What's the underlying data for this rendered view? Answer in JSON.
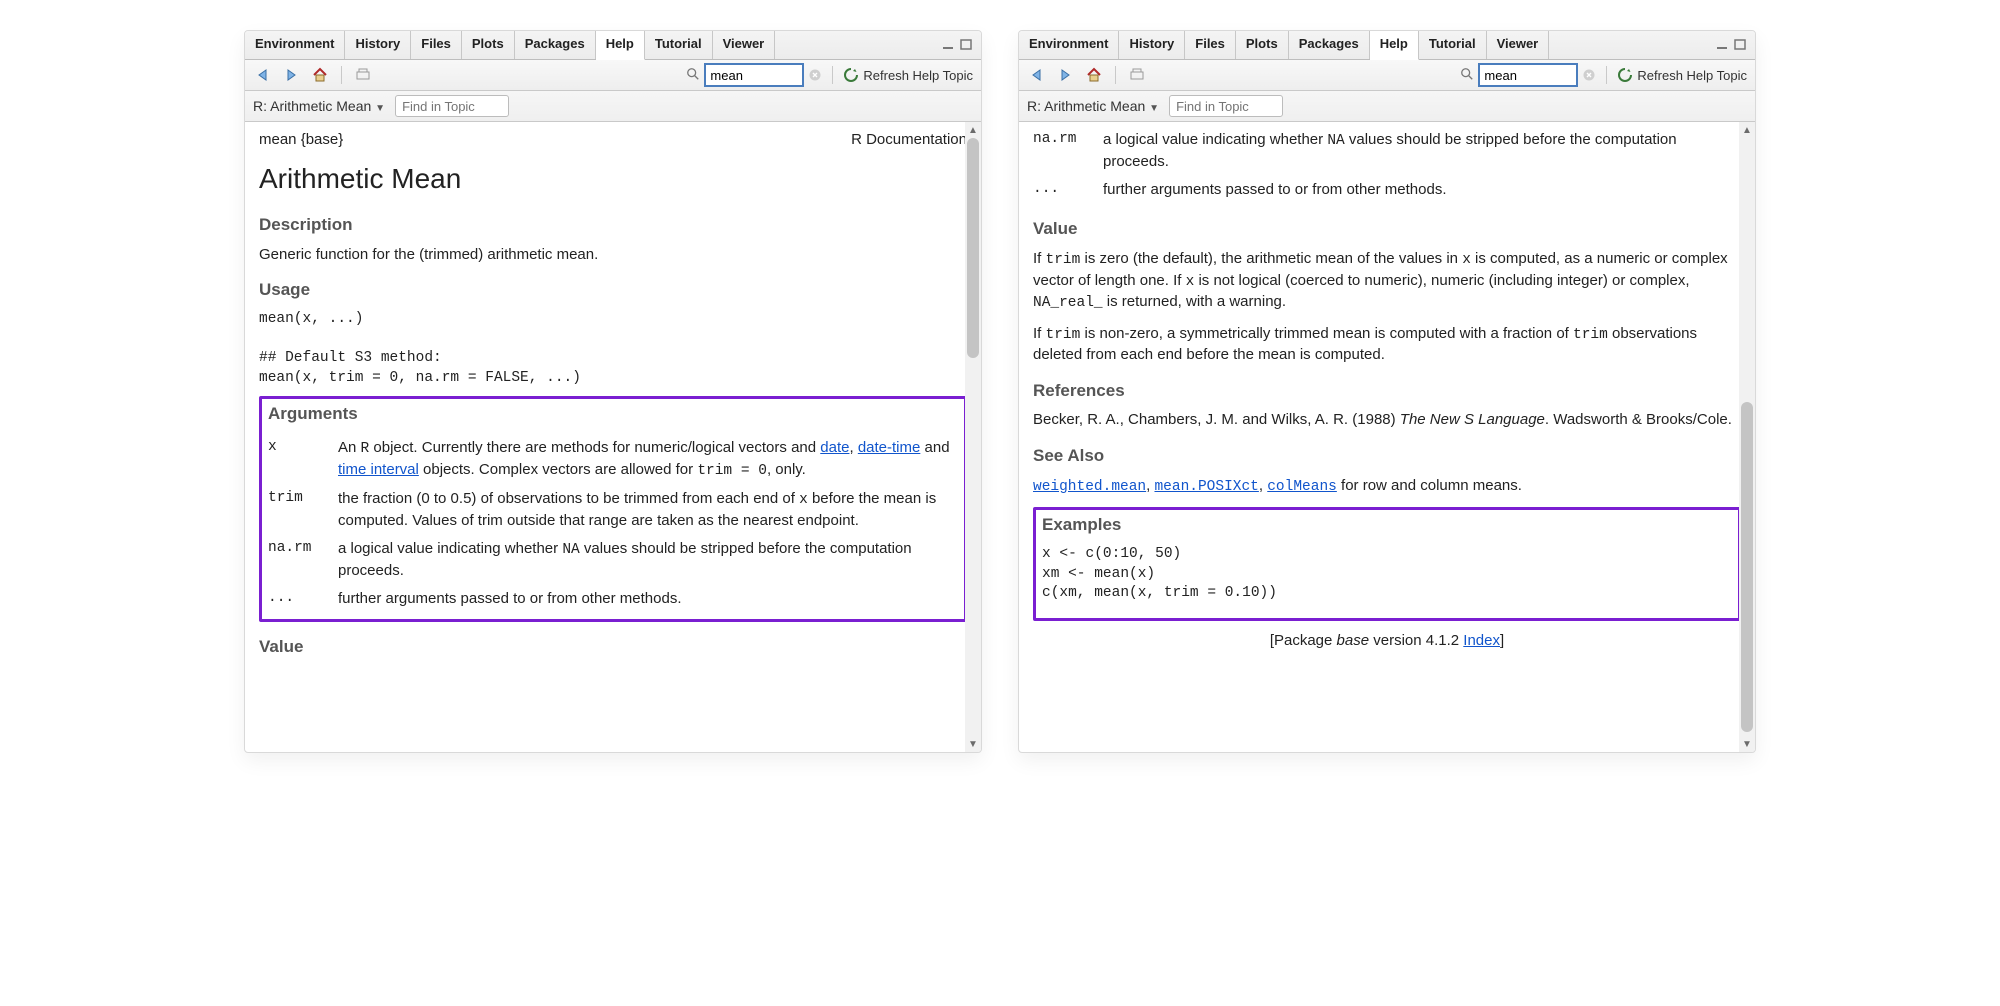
{
  "tabs": {
    "environment": "Environment",
    "history": "History",
    "files": "Files",
    "plots": "Plots",
    "packages": "Packages",
    "help": "Help",
    "tutorial": "Tutorial",
    "viewer": "Viewer"
  },
  "toolbar": {
    "search_value": "mean",
    "refresh": "Refresh Help Topic",
    "find_placeholder": "Find in Topic",
    "topic_label": "R: Arithmetic Mean"
  },
  "doc": {
    "pkg": "mean {base}",
    "rdoc": "R Documentation",
    "title": "Arithmetic Mean",
    "h_desc": "Description",
    "desc": "Generic function for the (trimmed) arithmetic mean.",
    "h_usage": "Usage",
    "usage": "mean(x, ...)\n\n## Default S3 method:\nmean(x, trim = 0, na.rm = FALSE, ...)",
    "h_args": "Arguments",
    "args_x_pre": "An ",
    "args_x_mid": " object. Currently there are methods for numeric/logical vectors and ",
    "link_date": "date",
    "args_x_comma": ", ",
    "link_datetime": "date-time",
    "args_x_and": " and ",
    "link_timeint": "time interval",
    "args_x_post1": " objects. Complex vectors are allowed for ",
    "args_x_code": "trim = 0",
    "args_x_post2": ", only.",
    "args_trim_pre": "the fraction (0 to 0.5) of observations to be trimmed from each end of ",
    "args_trim_post": " before the mean is computed. Values of trim outside that range are taken as the nearest endpoint.",
    "args_narm_pre": "a logical value indicating whether ",
    "args_narm_post": " values should be stripped before the computation proceeds.",
    "args_dots": "further arguments passed to or from other methods.",
    "argname_x": "x",
    "argname_trim": "trim",
    "argname_narm": "na.rm",
    "argname_dots": "...",
    "code_R": "R",
    "code_x": "x",
    "code_NA": "NA",
    "h_value": "Value",
    "value1a": "If ",
    "value1b": " is zero (the default), the arithmetic mean of the values in ",
    "value1c": " is computed, as a numeric or complex vector of length one. If ",
    "value1d": " is not logical (coerced to numeric), numeric (including integer) or complex, ",
    "value1e": " is returned, with a warning.",
    "value2a": "If ",
    "value2b": " is non-zero, a symmetrically trimmed mean is computed with a fraction of ",
    "value2c": " observations deleted from each end before the mean is computed.",
    "code_trim": "trim",
    "code_NAreal": "NA_real_",
    "h_refs": "References",
    "refs_a": "Becker, R. A., Chambers, J. M. and Wilks, A. R. (1988) ",
    "refs_i": "The New S Language",
    "refs_b": ". Wadsworth & Brooks/Cole.",
    "h_seealso": "See Also",
    "sa_wm": "weighted.mean",
    "sa_mp": "mean.POSIXct",
    "sa_cm": "colMeans",
    "sa_tail": " for row and column means.",
    "sep": ", ",
    "h_examples": "Examples",
    "examples": "x <- c(0:10, 50)\nxm <- mean(x)\nc(xm, mean(x, trim = 0.10))",
    "footer_a": "[Package ",
    "footer_pkg": "base",
    "footer_b": " version 4.1.2 ",
    "footer_idx": "Index",
    "footer_c": "]"
  }
}
